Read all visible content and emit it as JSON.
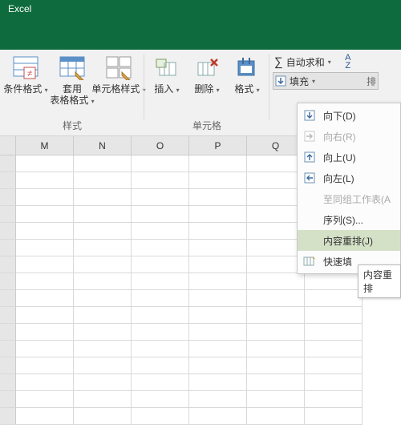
{
  "title": "Excel",
  "ribbon": {
    "groups": {
      "styles": {
        "label": "样式",
        "cond_format": "条件格式",
        "table_format": "套用\n表格格式",
        "cell_styles": "单元格样式"
      },
      "cells": {
        "label": "单元格",
        "insert": "插入",
        "delete": "删除",
        "format": "格式"
      }
    },
    "right": {
      "autosum": "自动求和",
      "fill": "填充",
      "sort_label": "排"
    }
  },
  "columns": [
    "M",
    "N",
    "O",
    "P",
    "Q"
  ],
  "menu": {
    "down": "向下(D)",
    "right": "向右(R)",
    "up": "向上(U)",
    "left": "向左(L)",
    "group": "至同组工作表(A",
    "series": "序列(S)...",
    "justify": "内容重排(J)",
    "flash": "快速填"
  },
  "tooltip": "内容重排"
}
